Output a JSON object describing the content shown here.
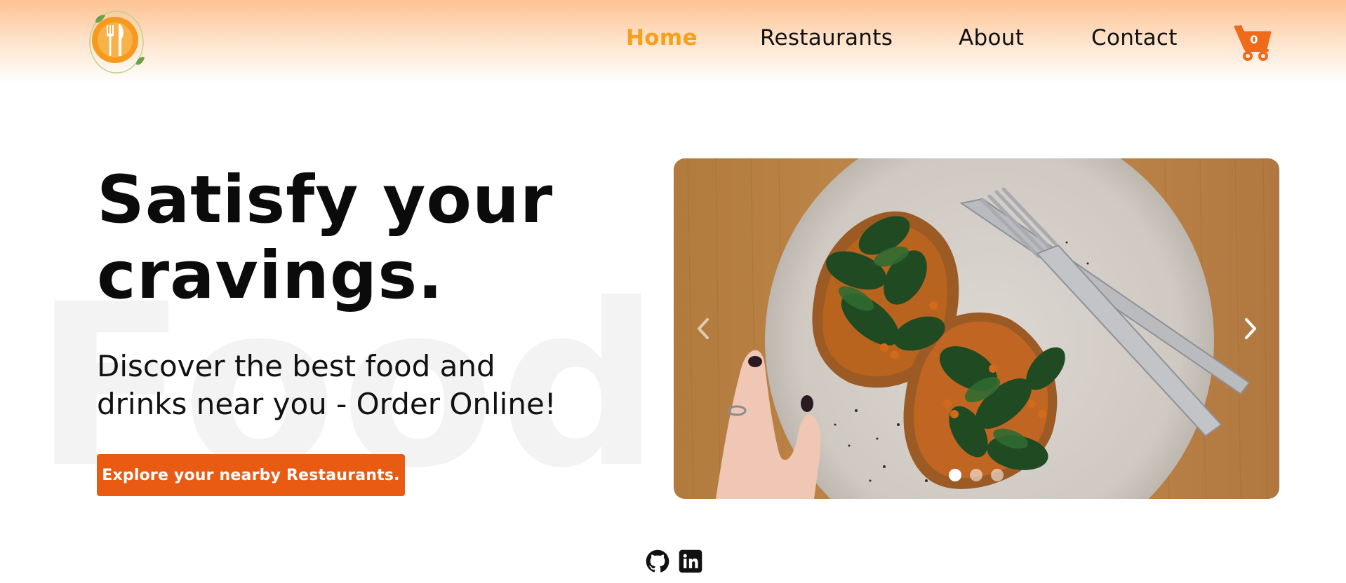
{
  "header": {
    "logo_icon": "fork-knife-plate-logo",
    "nav": [
      {
        "label": "Home",
        "active": true
      },
      {
        "label": "Restaurants",
        "active": false
      },
      {
        "label": "About",
        "active": false
      },
      {
        "label": "Contact",
        "active": false
      }
    ],
    "cart": {
      "icon": "cart-icon",
      "count": "0"
    }
  },
  "hero": {
    "watermark": "FoodH",
    "title_line1": "Satisfy your",
    "title_line2": "cravings.",
    "subtitle_line1": "Discover the best food and",
    "subtitle_line2": "drinks near you - Order Online!",
    "cta_label": "Explore your nearby Restaurants."
  },
  "carousel": {
    "slide_count": 3,
    "active_slide": 1,
    "prev_icon": "chevron-left-icon",
    "next_icon": "chevron-right-icon"
  },
  "footer": {
    "social": [
      "github-icon",
      "linkedin-icon"
    ]
  },
  "colors": {
    "accent": "#f7a11a",
    "cta": "#e95a13",
    "header_gradient_top": "#fdc292",
    "cart": "#f06a1c"
  }
}
